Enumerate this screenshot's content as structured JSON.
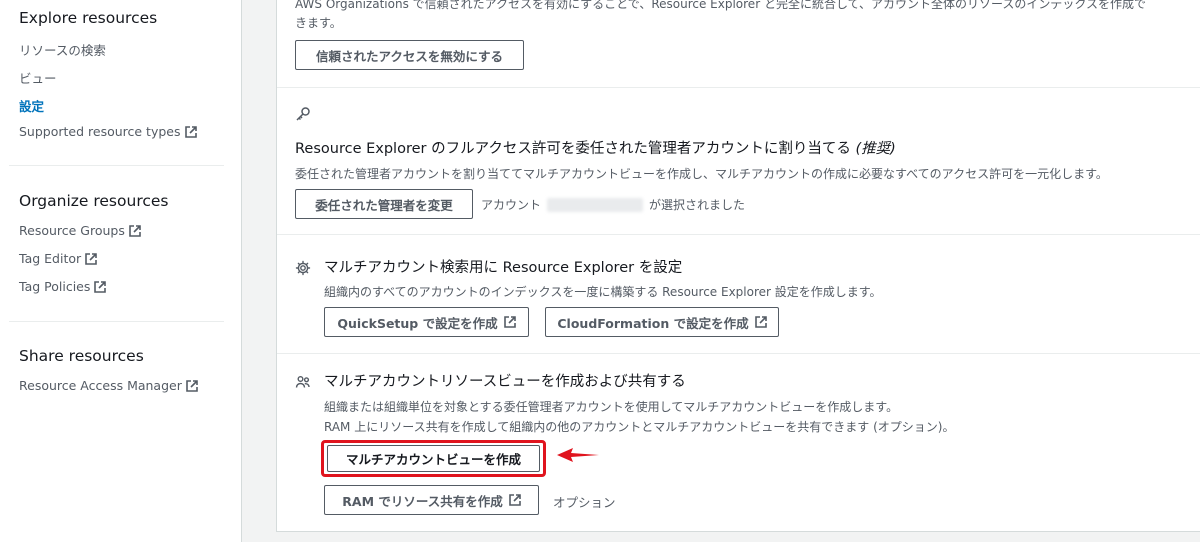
{
  "sidebar": {
    "sections": [
      {
        "heading": "Explore resources",
        "items": [
          {
            "label": "リソースの検索",
            "external": false,
            "active": false
          },
          {
            "label": "ビュー",
            "external": false,
            "active": false
          },
          {
            "label": "設定",
            "external": false,
            "active": true
          },
          {
            "label": "Supported resource types",
            "external": true,
            "active": false
          }
        ]
      },
      {
        "heading": "Organize resources",
        "items": [
          {
            "label": "Resource Groups",
            "external": true,
            "active": false
          },
          {
            "label": "Tag Editor",
            "external": true,
            "active": false
          },
          {
            "label": "Tag Policies",
            "external": true,
            "active": false
          }
        ]
      },
      {
        "heading": "Share resources",
        "items": [
          {
            "label": "Resource Access Manager",
            "external": true,
            "active": false
          }
        ]
      }
    ]
  },
  "trusted_access": {
    "description_line1": "AWS Organizations で信頼されたアクセスを有効にすることで、Resource Explorer と完全に統合して、アカウント全体のリソースのインデックスを作成で",
    "description_line2": "きます。",
    "disable_button": "信頼されたアクセスを無効にする"
  },
  "delegated_admin": {
    "icon": "key-icon",
    "title": "Resource Explorer のフルアクセス許可を委任された管理者アカウントに割り当てる",
    "title_suffix": "(推奨)",
    "description": "委任された管理者アカウントを割り当ててマルチアカウントビューを作成し、マルチアカウントの作成に必要なすべてのアクセス許可を一元化します。",
    "change_button": "委任された管理者を変更",
    "account_prefix": "アカウント",
    "account_suffix": "が選択されました"
  },
  "multi_search": {
    "icon": "gear-icon",
    "title": "マルチアカウント検索用に Resource Explorer を設定",
    "description": "組織内のすべてのアカウントのインデックスを一度に構築する Resource Explorer 設定を作成します。",
    "quicksetup_button": "QuickSetup で設定を作成",
    "cloudformation_button": "CloudFormation で設定を作成"
  },
  "multi_view": {
    "icon": "users-icon",
    "title": "マルチアカウントリソースビューを作成および共有する",
    "description_line1": "組織または組織単位を対象とする委任管理者アカウントを使用してマルチアカウントビューを作成します。",
    "description_line2": "RAM 上にリソース共有を作成して組織内の他のアカウントとマルチアカウントビューを共有できます (オプション)。",
    "create_view_button": "マルチアカウントビューを作成",
    "ram_share_button": "RAM でリソース共有を作成",
    "optional_label": "オプション"
  },
  "colors": {
    "highlight": "#e0141e",
    "link_active": "#0073bb"
  }
}
